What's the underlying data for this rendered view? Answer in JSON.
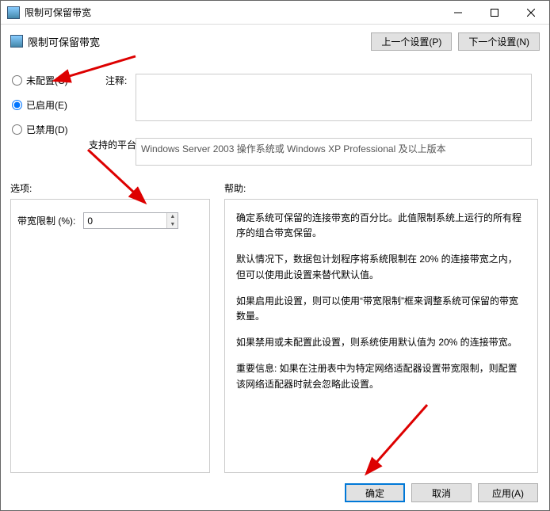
{
  "window": {
    "title": "限制可保留带宽"
  },
  "header": {
    "title": "限制可保留带宽"
  },
  "nav": {
    "prev": "上一个设置(P)",
    "next": "下一个设置(N)"
  },
  "radios": {
    "not_configured": "未配置(C)",
    "enabled": "已启用(E)",
    "disabled": "已禁用(D)"
  },
  "labels": {
    "comment": "注释:",
    "platform": "支持的平台:",
    "options": "选项:",
    "help": "帮助:"
  },
  "platform_text": "Windows Server 2003 操作系统或 Windows XP Professional 及以上版本",
  "options": {
    "bandwidth_label": "带宽限制 (%):",
    "bandwidth_value": "0"
  },
  "help": {
    "p1": "确定系统可保留的连接带宽的百分比。此值限制系统上运行的所有程序的组合带宽保留。",
    "p2": "默认情况下，数据包计划程序将系统限制在 20% 的连接带宽之内，但可以使用此设置来替代默认值。",
    "p3": "如果启用此设置，则可以使用“带宽限制”框来调整系统可保留的带宽数量。",
    "p4": "如果禁用或未配置此设置，则系统使用默认值为 20% 的连接带宽。",
    "p5": "重要信息: 如果在注册表中为特定网络适配器设置带宽限制，则配置该网络适配器时就会忽略此设置。"
  },
  "buttons": {
    "ok": "确定",
    "cancel": "取消",
    "apply": "应用(A)"
  }
}
